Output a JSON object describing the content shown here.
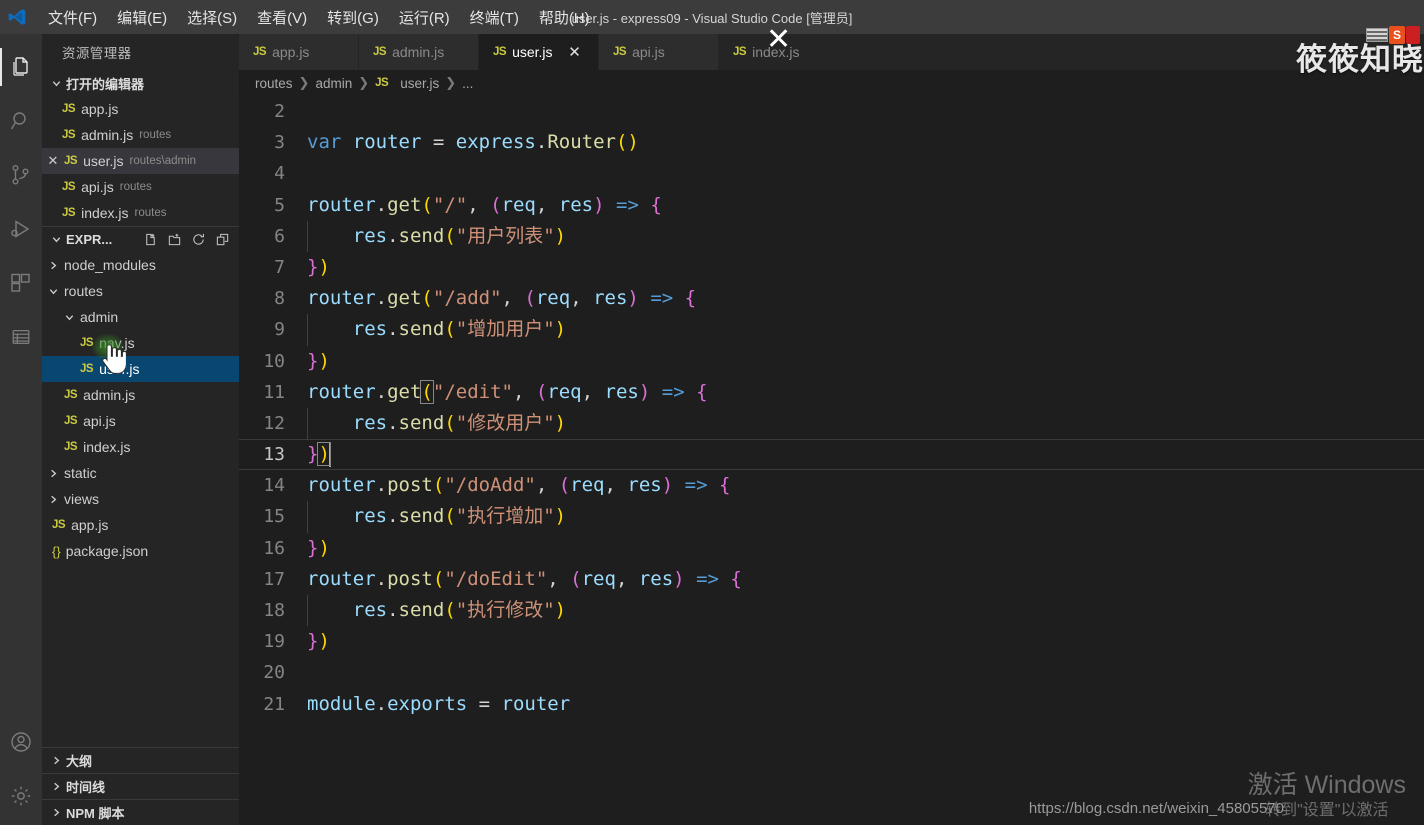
{
  "titlebar": {
    "logo_icon": "vscode-logo-icon",
    "window_title": "user.js - express09 - Visual Studio Code [管理员]",
    "menus": [
      {
        "label": "文件(F)",
        "name": "menu-file"
      },
      {
        "label": "编辑(E)",
        "name": "menu-edit"
      },
      {
        "label": "选择(S)",
        "name": "menu-selection"
      },
      {
        "label": "查看(V)",
        "name": "menu-view"
      },
      {
        "label": "转到(G)",
        "name": "menu-goto"
      },
      {
        "label": "运行(R)",
        "name": "menu-run"
      },
      {
        "label": "终端(T)",
        "name": "menu-terminal"
      },
      {
        "label": "帮助(H)",
        "name": "menu-help"
      }
    ]
  },
  "activitybar": {
    "items": [
      {
        "icon": "files-explorer-icon",
        "name": "activity-explorer",
        "active": true
      },
      {
        "icon": "search-icon",
        "name": "activity-search",
        "active": false
      },
      {
        "icon": "source-control-icon",
        "name": "activity-source-control",
        "active": false
      },
      {
        "icon": "run-debug-icon",
        "name": "activity-run-debug",
        "active": false
      },
      {
        "icon": "extensions-icon",
        "name": "activity-extensions",
        "active": false
      },
      {
        "icon": "database-list-icon",
        "name": "activity-database",
        "active": false
      }
    ],
    "bottom": [
      {
        "icon": "account-icon",
        "name": "activity-account"
      },
      {
        "icon": "gear-icon",
        "name": "activity-settings"
      }
    ]
  },
  "sidebar": {
    "title": "资源管理器",
    "open_editors": {
      "label": "打开的编辑器",
      "expanded": true,
      "items": [
        {
          "icon": "js-file-icon",
          "name": "app.js",
          "desc": "",
          "selected": false,
          "has_close": false
        },
        {
          "icon": "js-file-icon",
          "name": "admin.js",
          "desc": "routes",
          "selected": false,
          "has_close": false
        },
        {
          "icon": "js-file-icon",
          "name": "user.js",
          "desc": "routes\\admin",
          "selected": true,
          "has_close": true
        },
        {
          "icon": "js-file-icon",
          "name": "api.js",
          "desc": "routes",
          "selected": false,
          "has_close": false
        },
        {
          "icon": "js-file-icon",
          "name": "index.js",
          "desc": "routes",
          "selected": false,
          "has_close": false
        }
      ]
    },
    "explorer_section": {
      "label": "EXPR...",
      "expanded": true,
      "actions": [
        {
          "icon": "new-file-icon",
          "name": "new-file-button"
        },
        {
          "icon": "new-folder-icon",
          "name": "new-folder-button"
        },
        {
          "icon": "refresh-icon",
          "name": "refresh-explorer-button"
        },
        {
          "icon": "collapse-all-icon",
          "name": "collapse-all-button"
        }
      ]
    },
    "tree": [
      {
        "label": "node_modules",
        "type": "folder",
        "depth": 0,
        "expanded": false,
        "selected": false
      },
      {
        "label": "routes",
        "type": "folder",
        "depth": 0,
        "expanded": true,
        "selected": false
      },
      {
        "label": "admin",
        "type": "folder",
        "depth": 1,
        "expanded": true,
        "selected": false
      },
      {
        "label": "nav.js",
        "type": "js",
        "depth": 2,
        "expanded": null,
        "selected": false
      },
      {
        "label": "user.js",
        "type": "js",
        "depth": 2,
        "expanded": null,
        "selected": true
      },
      {
        "label": "admin.js",
        "type": "js",
        "depth": 1,
        "expanded": null,
        "selected": false
      },
      {
        "label": "api.js",
        "type": "js",
        "depth": 1,
        "expanded": null,
        "selected": false
      },
      {
        "label": "index.js",
        "type": "js",
        "depth": 1,
        "expanded": null,
        "selected": false
      },
      {
        "label": "static",
        "type": "folder",
        "depth": 0,
        "expanded": false,
        "selected": false
      },
      {
        "label": "views",
        "type": "folder",
        "depth": 0,
        "expanded": false,
        "selected": false
      },
      {
        "label": "app.js",
        "type": "js",
        "depth": 0,
        "expanded": null,
        "selected": false
      },
      {
        "label": "package.json",
        "type": "json",
        "depth": 0,
        "expanded": null,
        "selected": false
      }
    ],
    "bottom_panels": [
      {
        "label": "大纲",
        "name": "panel-outline"
      },
      {
        "label": "时间线",
        "name": "panel-timeline"
      },
      {
        "label": "NPM 脚本",
        "name": "panel-npm-scripts"
      }
    ]
  },
  "editor": {
    "tabs": [
      {
        "label": "app.js",
        "icon": "js-file-icon",
        "active": false,
        "close": false
      },
      {
        "label": "admin.js",
        "icon": "js-file-icon",
        "active": false,
        "close": false
      },
      {
        "label": "user.js",
        "icon": "js-file-icon",
        "active": true,
        "close": true
      },
      {
        "label": "api.js",
        "icon": "js-file-icon",
        "active": false,
        "close": false
      },
      {
        "label": "index.js",
        "icon": "js-file-icon",
        "active": false,
        "close": false
      }
    ],
    "tab_close_glyph": "✕",
    "breadcrumbs": [
      "routes",
      "admin",
      "user.js",
      "..."
    ],
    "breadcrumb_file_icon": "js-file-icon",
    "current_line": 13,
    "lines": [
      {
        "n": 2,
        "tokens": []
      },
      {
        "n": 3,
        "tokens": [
          {
            "t": "var",
            "c": "t-key"
          },
          {
            "t": " ",
            "c": "t-plain"
          },
          {
            "t": "router",
            "c": "t-var"
          },
          {
            "t": " ",
            "c": "t-plain"
          },
          {
            "t": "=",
            "c": "t-op"
          },
          {
            "t": " ",
            "c": "t-plain"
          },
          {
            "t": "express",
            "c": "t-var"
          },
          {
            "t": ".",
            "c": "t-punc"
          },
          {
            "t": "Router",
            "c": "t-fn"
          },
          {
            "t": "(",
            "c": "t-brk1"
          },
          {
            "t": ")",
            "c": "t-brk1"
          }
        ]
      },
      {
        "n": 4,
        "tokens": []
      },
      {
        "n": 5,
        "tokens": [
          {
            "t": "router",
            "c": "t-var"
          },
          {
            "t": ".",
            "c": "t-punc"
          },
          {
            "t": "get",
            "c": "t-fn"
          },
          {
            "t": "(",
            "c": "t-brk1"
          },
          {
            "t": "\"/\"",
            "c": "t-str"
          },
          {
            "t": ", ",
            "c": "t-punc"
          },
          {
            "t": "(",
            "c": "t-brk2"
          },
          {
            "t": "req",
            "c": "t-var"
          },
          {
            "t": ", ",
            "c": "t-punc"
          },
          {
            "t": "res",
            "c": "t-var"
          },
          {
            "t": ")",
            "c": "t-brk2"
          },
          {
            "t": " ",
            "c": "t-plain"
          },
          {
            "t": "=>",
            "c": "t-arrow"
          },
          {
            "t": " ",
            "c": "t-plain"
          },
          {
            "t": "{",
            "c": "t-brk2"
          }
        ]
      },
      {
        "n": 6,
        "tokens": [
          {
            "t": "    ",
            "c": "t-plain"
          },
          {
            "t": "res",
            "c": "t-var"
          },
          {
            "t": ".",
            "c": "t-punc"
          },
          {
            "t": "send",
            "c": "t-fn"
          },
          {
            "t": "(",
            "c": "t-brk1"
          },
          {
            "t": "\"用户列表\"",
            "c": "t-str"
          },
          {
            "t": ")",
            "c": "t-brk1"
          }
        ]
      },
      {
        "n": 7,
        "tokens": [
          {
            "t": "}",
            "c": "t-brk2"
          },
          {
            "t": ")",
            "c": "t-brk1"
          }
        ]
      },
      {
        "n": 8,
        "tokens": [
          {
            "t": "router",
            "c": "t-var"
          },
          {
            "t": ".",
            "c": "t-punc"
          },
          {
            "t": "get",
            "c": "t-fn"
          },
          {
            "t": "(",
            "c": "t-brk1"
          },
          {
            "t": "\"/add\"",
            "c": "t-str"
          },
          {
            "t": ", ",
            "c": "t-punc"
          },
          {
            "t": "(",
            "c": "t-brk2"
          },
          {
            "t": "req",
            "c": "t-var"
          },
          {
            "t": ", ",
            "c": "t-punc"
          },
          {
            "t": "res",
            "c": "t-var"
          },
          {
            "t": ")",
            "c": "t-brk2"
          },
          {
            "t": " ",
            "c": "t-plain"
          },
          {
            "t": "=>",
            "c": "t-arrow"
          },
          {
            "t": " ",
            "c": "t-plain"
          },
          {
            "t": "{",
            "c": "t-brk2"
          }
        ]
      },
      {
        "n": 9,
        "tokens": [
          {
            "t": "    ",
            "c": "t-plain"
          },
          {
            "t": "res",
            "c": "t-var"
          },
          {
            "t": ".",
            "c": "t-punc"
          },
          {
            "t": "send",
            "c": "t-fn"
          },
          {
            "t": "(",
            "c": "t-brk1"
          },
          {
            "t": "\"增加用户\"",
            "c": "t-str"
          },
          {
            "t": ")",
            "c": "t-brk1"
          }
        ]
      },
      {
        "n": 10,
        "tokens": [
          {
            "t": "}",
            "c": "t-brk2"
          },
          {
            "t": ")",
            "c": "t-brk1"
          }
        ]
      },
      {
        "n": 11,
        "tokens": [
          {
            "t": "router",
            "c": "t-var"
          },
          {
            "t": ".",
            "c": "t-punc"
          },
          {
            "t": "get",
            "c": "t-fn"
          },
          {
            "t": "(",
            "c": "t-brk1 bracket-box"
          },
          {
            "t": "\"/edit\"",
            "c": "t-str"
          },
          {
            "t": ", ",
            "c": "t-punc"
          },
          {
            "t": "(",
            "c": "t-brk2"
          },
          {
            "t": "req",
            "c": "t-var"
          },
          {
            "t": ", ",
            "c": "t-punc"
          },
          {
            "t": "res",
            "c": "t-var"
          },
          {
            "t": ")",
            "c": "t-brk2"
          },
          {
            "t": " ",
            "c": "t-plain"
          },
          {
            "t": "=>",
            "c": "t-arrow"
          },
          {
            "t": " ",
            "c": "t-plain"
          },
          {
            "t": "{",
            "c": "t-brk2"
          }
        ]
      },
      {
        "n": 12,
        "tokens": [
          {
            "t": "    ",
            "c": "t-plain"
          },
          {
            "t": "res",
            "c": "t-var"
          },
          {
            "t": ".",
            "c": "t-punc"
          },
          {
            "t": "send",
            "c": "t-fn"
          },
          {
            "t": "(",
            "c": "t-brk1"
          },
          {
            "t": "\"修改用户\"",
            "c": "t-str"
          },
          {
            "t": ")",
            "c": "t-brk1"
          }
        ]
      },
      {
        "n": 13,
        "tokens": [
          {
            "t": "}",
            "c": "t-brk2"
          },
          {
            "t": ")",
            "c": "t-brk1 bracket-box"
          }
        ]
      },
      {
        "n": 14,
        "tokens": [
          {
            "t": "router",
            "c": "t-var"
          },
          {
            "t": ".",
            "c": "t-punc"
          },
          {
            "t": "post",
            "c": "t-fn"
          },
          {
            "t": "(",
            "c": "t-brk1"
          },
          {
            "t": "\"/doAdd\"",
            "c": "t-str"
          },
          {
            "t": ", ",
            "c": "t-punc"
          },
          {
            "t": "(",
            "c": "t-brk2"
          },
          {
            "t": "req",
            "c": "t-var"
          },
          {
            "t": ", ",
            "c": "t-punc"
          },
          {
            "t": "res",
            "c": "t-var"
          },
          {
            "t": ")",
            "c": "t-brk2"
          },
          {
            "t": " ",
            "c": "t-plain"
          },
          {
            "t": "=>",
            "c": "t-arrow"
          },
          {
            "t": " ",
            "c": "t-plain"
          },
          {
            "t": "{",
            "c": "t-brk2"
          }
        ]
      },
      {
        "n": 15,
        "tokens": [
          {
            "t": "    ",
            "c": "t-plain"
          },
          {
            "t": "res",
            "c": "t-var"
          },
          {
            "t": ".",
            "c": "t-punc"
          },
          {
            "t": "send",
            "c": "t-fn"
          },
          {
            "t": "(",
            "c": "t-brk1"
          },
          {
            "t": "\"执行增加\"",
            "c": "t-str"
          },
          {
            "t": ")",
            "c": "t-brk1"
          }
        ]
      },
      {
        "n": 16,
        "tokens": [
          {
            "t": "}",
            "c": "t-brk2"
          },
          {
            "t": ")",
            "c": "t-brk1"
          }
        ]
      },
      {
        "n": 17,
        "tokens": [
          {
            "t": "router",
            "c": "t-var"
          },
          {
            "t": ".",
            "c": "t-punc"
          },
          {
            "t": "post",
            "c": "t-fn"
          },
          {
            "t": "(",
            "c": "t-brk1"
          },
          {
            "t": "\"/doEdit\"",
            "c": "t-str"
          },
          {
            "t": ", ",
            "c": "t-punc"
          },
          {
            "t": "(",
            "c": "t-brk2"
          },
          {
            "t": "req",
            "c": "t-var"
          },
          {
            "t": ", ",
            "c": "t-punc"
          },
          {
            "t": "res",
            "c": "t-var"
          },
          {
            "t": ")",
            "c": "t-brk2"
          },
          {
            "t": " ",
            "c": "t-plain"
          },
          {
            "t": "=>",
            "c": "t-arrow"
          },
          {
            "t": " ",
            "c": "t-plain"
          },
          {
            "t": "{",
            "c": "t-brk2"
          }
        ]
      },
      {
        "n": 18,
        "tokens": [
          {
            "t": "    ",
            "c": "t-plain"
          },
          {
            "t": "res",
            "c": "t-var"
          },
          {
            "t": ".",
            "c": "t-punc"
          },
          {
            "t": "send",
            "c": "t-fn"
          },
          {
            "t": "(",
            "c": "t-brk1"
          },
          {
            "t": "\"执行修改\"",
            "c": "t-str"
          },
          {
            "t": ")",
            "c": "t-brk1"
          }
        ]
      },
      {
        "n": 19,
        "tokens": [
          {
            "t": "}",
            "c": "t-brk2"
          },
          {
            "t": ")",
            "c": "t-brk1"
          }
        ]
      },
      {
        "n": 20,
        "tokens": []
      },
      {
        "n": 21,
        "tokens": [
          {
            "t": "module",
            "c": "t-var"
          },
          {
            "t": ".",
            "c": "t-punc"
          },
          {
            "t": "exports",
            "c": "t-var"
          },
          {
            "t": " ",
            "c": "t-plain"
          },
          {
            "t": "=",
            "c": "t-op"
          },
          {
            "t": " ",
            "c": "t-plain"
          },
          {
            "t": "router",
            "c": "t-var"
          }
        ]
      }
    ]
  },
  "overlays": {
    "watermark_text": "筱筱知晓",
    "windows_activation_line1": "激活 Windows",
    "windows_activation_line2": "转到\"设置\"以激活",
    "blog_url": "https://blog.csdn.net/weixin_45805570",
    "floating_close_glyph": "✕"
  },
  "colors": {
    "accent_blue": "#094771",
    "js_yellow": "#cbcb41",
    "string_orange": "#ce9178",
    "keyword_blue": "#569cd6",
    "function_yellow": "#dcdcaa",
    "variable_light_blue": "#9cdcfe",
    "titlebar_bg": "#3c3c3c",
    "sidebar_bg": "#252526",
    "editor_bg": "#1e1e1e",
    "activitybar_bg": "#333333"
  }
}
